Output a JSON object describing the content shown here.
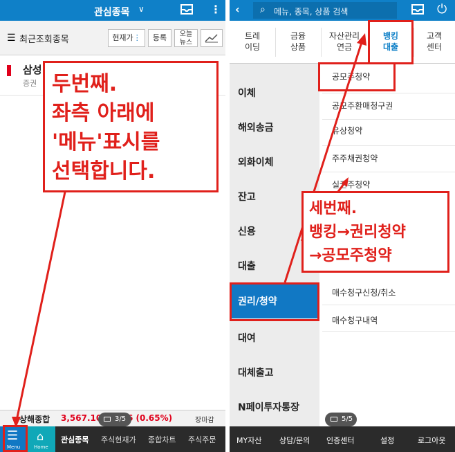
{
  "left": {
    "header": {
      "title": "관심종목",
      "title_chevron": "∨"
    },
    "subbar": {
      "label": "최근조회종목",
      "chips": [
        "현재가",
        "등록",
        "오늘",
        "뉴스"
      ]
    },
    "stock": {
      "name": "삼성",
      "sub": "증권"
    },
    "index": {
      "name": "상해종합",
      "value": "3,567.10",
      "change": "6 (0.65%)",
      "tag": "장마감"
    },
    "pager": "3/5",
    "tabbar": {
      "menu_label": "Menu",
      "home_label": "Home",
      "tabs": [
        "관심종목",
        "주식현재가",
        "종합차트",
        "주식주문"
      ]
    },
    "callout": [
      "두번째.",
      "좌측 아래에",
      "'메뉴'표시를",
      "선택합니다."
    ]
  },
  "right": {
    "header": {
      "search_placeholder": "메뉴, 종목, 상품 검색"
    },
    "categories": [
      {
        "l1": "트레",
        "l2": "이딩"
      },
      {
        "l1": "금융",
        "l2": "상품"
      },
      {
        "l1": "자산관리",
        "l2": "연금"
      },
      {
        "l1": "뱅킹",
        "l2": "대출"
      },
      {
        "l1": "고객",
        "l2": "센터"
      }
    ],
    "nav": [
      "이체",
      "해외송금",
      "외화이체",
      "잔고",
      "신용",
      "대출",
      "권리/청약",
      "대여",
      "대체출고",
      "N페이투자통장"
    ],
    "sub_items": [
      "공모주청약",
      "공모주환매청구권",
      "유상청약",
      "주주채권청약",
      "실권주청약",
      "매수청구신청/취소",
      "매수청구내역"
    ],
    "pager": "5/5",
    "tabbar": [
      "MY자산",
      "상담/문의",
      "인증센터",
      "설정",
      "로그아웃"
    ],
    "callout": [
      "세번째.",
      "뱅킹→권리청약",
      "→공모주청약"
    ]
  }
}
